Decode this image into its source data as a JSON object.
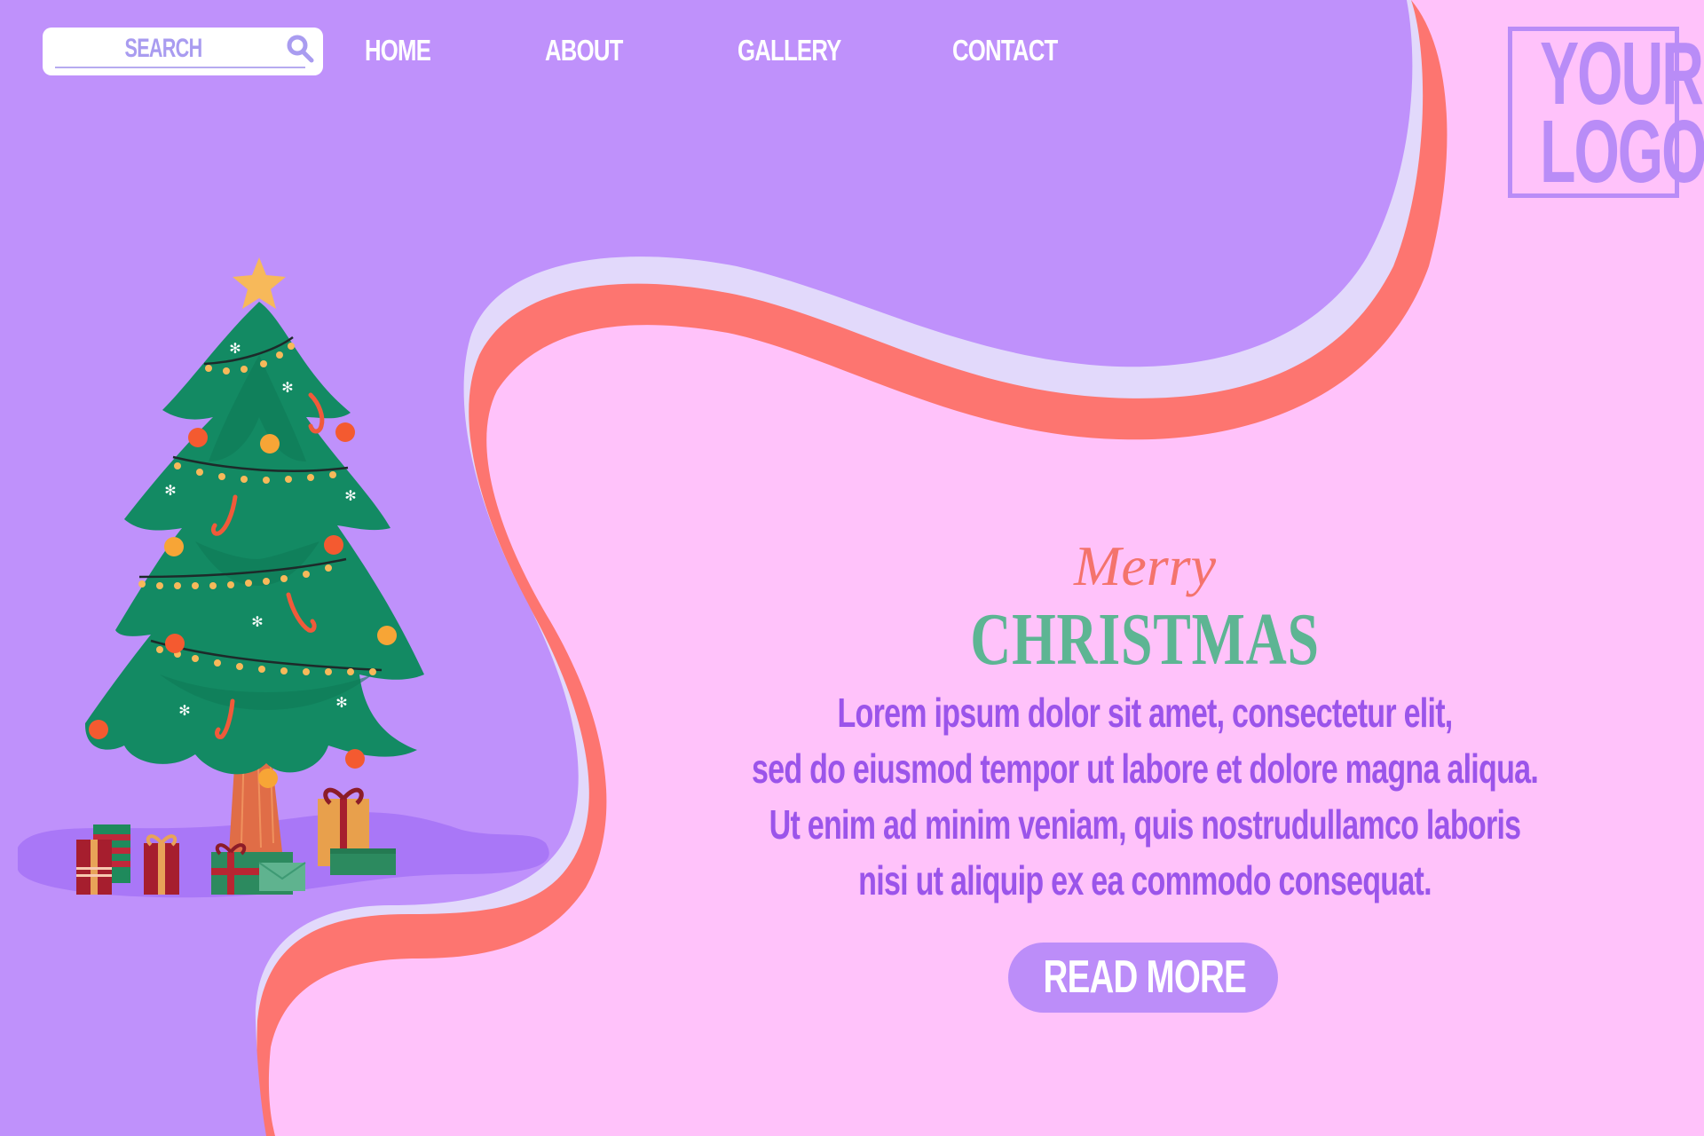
{
  "header": {
    "search": {
      "placeholder": "SEARCH",
      "value": "",
      "icon": "search-icon"
    },
    "nav": [
      {
        "label": "HOME"
      },
      {
        "label": "ABOUT"
      },
      {
        "label": "GALLERY"
      },
      {
        "label": "CONTACT"
      }
    ],
    "logo": {
      "line1": "YOUR",
      "line2": "LOGO"
    }
  },
  "hero": {
    "script_title": "Merry",
    "title": "CHRISTMAS",
    "body_lines": [
      "Lorem ipsum dolor sit amet, consectetur elit,",
      "sed do eiusmod tempor ut labore et dolore magna aliqua.",
      "Ut enim ad minim veniam, quis nostrudullamco laboris",
      "nisi ut aliquip ex ea commodo consequat."
    ],
    "cta_label": "READ MORE"
  },
  "illustration": {
    "subject": "christmas-tree-with-presents",
    "icons": [
      "star-icon",
      "christmas-tree-icon",
      "ornament-icon",
      "candy-cane-icon",
      "snowflake-icon",
      "gift-icon",
      "envelope-icon"
    ]
  },
  "colors": {
    "purple_bg": "#bf91fb",
    "pink_bg": "#ffc2fa",
    "lavender_band": "#e2d9fb",
    "coral_band": "#fd7570",
    "text_purple": "#9b54ea",
    "title_green": "#5db593",
    "merry_coral": "#f4736c",
    "button_purple": "#bc8df9",
    "logo_purple": "#b98cf7"
  }
}
